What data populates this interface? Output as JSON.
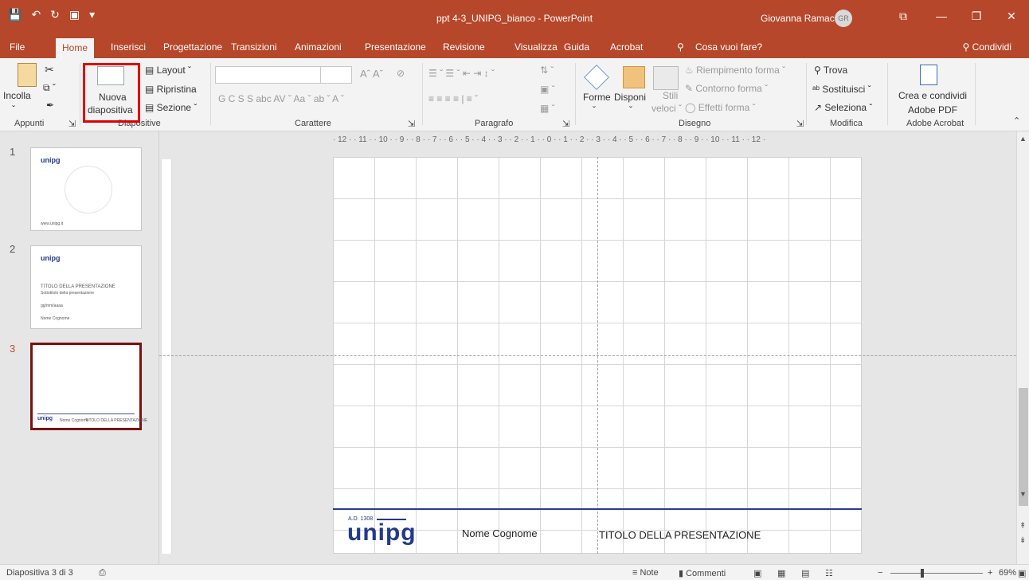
{
  "title_bar": {
    "document_title": "ppt 4-3_UNIPG_bianco - PowerPoint",
    "user_name": "Giovanna Ramaccini",
    "user_initials": "GR",
    "qat": {
      "save_icon": "save-icon",
      "undo_icon": "undo-icon",
      "redo_icon": "redo-icon",
      "present_icon": "present-icon",
      "customize": "▾"
    },
    "window_buttons": {
      "ribbon_options": "⧉",
      "minimize": "—",
      "restore": "❐",
      "close": "✕"
    }
  },
  "tabs": [
    {
      "label": "File"
    },
    {
      "label": "Home"
    },
    {
      "label": "Inserisci"
    },
    {
      "label": "Progettazione"
    },
    {
      "label": "Transizioni"
    },
    {
      "label": "Animazioni"
    },
    {
      "label": "Presentazione"
    },
    {
      "label": "Revisione"
    },
    {
      "label": "Visualizza"
    },
    {
      "label": "Guida"
    },
    {
      "label": "Acrobat"
    },
    {
      "label": "Cosa vuoi fare?"
    }
  ],
  "share_label": "Condividi",
  "ribbon": {
    "appunti": {
      "paste_label": "Incolla",
      "group_label": "Appunti"
    },
    "diapositive": {
      "new_slide_line1": "Nuova",
      "new_slide_line2": "diapositiva",
      "layout": "Layout ˇ",
      "ripristina": "Ripristina",
      "sezione": "Sezione ˇ",
      "group_label": "Diapositive"
    },
    "carattere": {
      "format_row": "G  C  S  S  abc  AV ˇ  Aa ˇ  ab ˇ  A ˇ",
      "grow_shrink": "Aˆ  Aˇ",
      "group_label": "Carattere"
    },
    "paragrafo": {
      "row1": "☰ ˇ  ☰ ˇ  ⇤  ⇥  ↕ ˇ",
      "row2": "≡  ≡  ≡  ≡  |  ≡ ˇ",
      "group_label": "Paragrafo"
    },
    "disegno": {
      "forme": "Forme",
      "disponi": "Disponi",
      "stili_line1": "Stili",
      "stili_line2": "veloci ˇ",
      "riempimento": "Riempimento forma ˇ",
      "contorno": "Contorno forma ˇ",
      "effetti": "Effetti forma ˇ",
      "group_label": "Disegno"
    },
    "modifica": {
      "trova": "Trova",
      "sostituisci": "Sostituisci ˇ",
      "seleziona": "Seleziona ˇ",
      "group_label": "Modifica"
    },
    "acrobat": {
      "crea_line1": "Crea e condividi",
      "crea_line2": "Adobe PDF",
      "group_label": "Adobe Acrobat"
    }
  },
  "thumbnails": [
    {
      "number": "1",
      "logo": "unipg",
      "footer_text": "www.unipg.it"
    },
    {
      "number": "2",
      "logo": "unipg",
      "title": "TITOLO DELLA PRESENTAZIONE",
      "subtitle": "Sottotitolo della presentazione",
      "date": "gg/mm/aaaa",
      "author": "Nome Cognome"
    },
    {
      "number": "3",
      "logo": "unipg",
      "author": "Nome Cognome",
      "title": "TITOLO DELLA PRESENTAZIONE"
    }
  ],
  "ruler": {
    "horizontal": "· 12 · · 11 · · 10 · · 9 · · 8 · · 7 · · 6 · · 5 · · 4 · · 3 · · 2 · · 1 · · 0 · · 1 · · 2 · · 3 · · 4 · · 5 · · 6 · · 7 · · 8 · · 9 · · 10 · · 11 · · 12 ·"
  },
  "slide": {
    "ad_text": "A.D. 1308",
    "logo": "unipg",
    "footer_name": "Nome Cognome",
    "footer_title": "TITOLO DELLA PRESENTAZIONE"
  },
  "status_bar": {
    "slide_info": "Diapositiva 3 di 3",
    "note": "Note",
    "commenti": "Commenti",
    "zoom_minus": "−",
    "zoom_plus": "+",
    "zoom_level": "69%"
  },
  "colors": {
    "accent": "#b7472a",
    "brand_blue": "#223a8a",
    "highlight_red": "#e20000"
  }
}
